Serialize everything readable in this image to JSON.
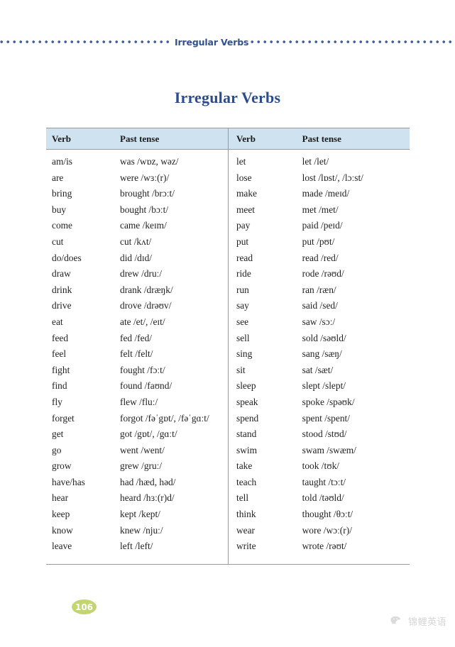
{
  "header": {
    "title": "Irregular Verbs",
    "rule_color": "#3b5ca0"
  },
  "page_title": "Irregular Verbs",
  "table": {
    "columns": [
      "Verb",
      "Past tense"
    ],
    "header_bg": "#cfe2ef",
    "left": [
      {
        "verb": "am/is",
        "past": "was /wɒz, wəz/"
      },
      {
        "verb": "are",
        "past": "were /wɜː(r)/"
      },
      {
        "verb": "bring",
        "past": "brought /brɔːt/"
      },
      {
        "verb": "buy",
        "past": "bought /bɔːt/"
      },
      {
        "verb": "come",
        "past": "came /keɪm/"
      },
      {
        "verb": "cut",
        "past": "cut /kʌt/"
      },
      {
        "verb": "do/does",
        "past": "did /dɪd/"
      },
      {
        "verb": "draw",
        "past": "drew /druː/"
      },
      {
        "verb": "drink",
        "past": "drank /dræŋk/"
      },
      {
        "verb": "drive",
        "past": "drove /drəʊv/"
      },
      {
        "verb": "eat",
        "past": "ate /et/, /eɪt/"
      },
      {
        "verb": "feed",
        "past": "fed /fed/"
      },
      {
        "verb": "feel",
        "past": "felt /felt/"
      },
      {
        "verb": "fight",
        "past": "fought /fɔːt/"
      },
      {
        "verb": "find",
        "past": "found /faʊnd/"
      },
      {
        "verb": "fly",
        "past": "flew /fluː/"
      },
      {
        "verb": "forget",
        "past": "forgot /fəˈgɒt/, /fəˈgɑːt/"
      },
      {
        "verb": "get",
        "past": "got /gɒt/, /gɑːt/"
      },
      {
        "verb": "go",
        "past": "went /went/"
      },
      {
        "verb": "grow",
        "past": "grew /gruː/"
      },
      {
        "verb": "have/has",
        "past": "had /hæd, həd/"
      },
      {
        "verb": "hear",
        "past": "heard /hɜː(r)d/"
      },
      {
        "verb": "keep",
        "past": "kept /kept/"
      },
      {
        "verb": "know",
        "past": "knew /njuː/"
      },
      {
        "verb": "leave",
        "past": "left /left/"
      }
    ],
    "right": [
      {
        "verb": "let",
        "past": "let /let/"
      },
      {
        "verb": "lose",
        "past": "lost /lɒst/, /lɔːst/"
      },
      {
        "verb": "make",
        "past": "made /meɪd/"
      },
      {
        "verb": "meet",
        "past": "met /met/"
      },
      {
        "verb": "pay",
        "past": "paid /peɪd/"
      },
      {
        "verb": "put",
        "past": "put /pʊt/"
      },
      {
        "verb": "read",
        "past": "read /red/"
      },
      {
        "verb": "ride",
        "past": "rode /rəʊd/"
      },
      {
        "verb": "run",
        "past": "ran /ræn/"
      },
      {
        "verb": "say",
        "past": "said /sed/"
      },
      {
        "verb": "see",
        "past": "saw /sɔː/"
      },
      {
        "verb": "sell",
        "past": "sold /səʊld/"
      },
      {
        "verb": "sing",
        "past": "sang /sæŋ/"
      },
      {
        "verb": "sit",
        "past": "sat /sæt/"
      },
      {
        "verb": "sleep",
        "past": "slept /slept/"
      },
      {
        "verb": "speak",
        "past": "spoke /spəʊk/"
      },
      {
        "verb": "spend",
        "past": "spent /spent/"
      },
      {
        "verb": "stand",
        "past": "stood /stʊd/"
      },
      {
        "verb": "swim",
        "past": "swam /swæm/"
      },
      {
        "verb": "take",
        "past": "took /tʊk/"
      },
      {
        "verb": "teach",
        "past": "taught /tɔːt/"
      },
      {
        "verb": "tell",
        "past": "told /təʊld/"
      },
      {
        "verb": "think",
        "past": "thought /θɔːt/"
      },
      {
        "verb": "wear",
        "past": "wore /wɔː(r)/"
      },
      {
        "verb": "write",
        "past": "wrote /rəʊt/"
      }
    ]
  },
  "page_number": "106",
  "page_number_color": "#c3d473",
  "footer": {
    "icon": "wechat-icon",
    "text": "锦鲤英语"
  }
}
